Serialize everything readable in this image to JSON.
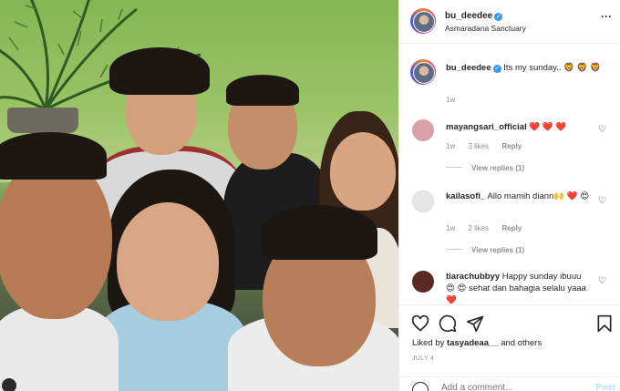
{
  "post": {
    "username": "bu_deedee",
    "location": "Asmaradana Sanctuary",
    "caption": "Its my sunday..",
    "caption_emoji": "🦁 🦁 🦁",
    "caption_time": "1w"
  },
  "comments": [
    {
      "username": "mayangsari_official",
      "text": "❤️ ❤️ ❤️",
      "time": "1w",
      "likes": "3 likes",
      "reply": "Reply",
      "view_replies": "View replies (1)",
      "avatar_color": "#d8a0a8"
    },
    {
      "username": "kailasofi_",
      "text": "Allo mamih diann🙌 ❤️ 😍",
      "time": "1w",
      "likes": "2 likes",
      "reply": "Reply",
      "view_replies": "View replies (1)",
      "avatar_color": "#e6e6e6"
    },
    {
      "username": "tiarachubbyy",
      "text": "Happy sunday ibuuu 😍 😍 sehat dan bahagia selalu yaaa❤️",
      "avatar_color": "#5a2a22"
    }
  ],
  "actions": {
    "icons": [
      "heart-icon",
      "comment-icon",
      "share-icon",
      "bookmark-icon"
    ],
    "liked_by_prefix": "Liked by",
    "liked_by_user": "tasyadeaa__",
    "liked_by_suffix": "and others",
    "date": "JULY 4"
  },
  "add_comment": {
    "placeholder": "Add a comment...",
    "post_label": "Post"
  },
  "colors": {
    "verified": "#3897f0",
    "secondary_text": "#8e8e8e",
    "post_disabled": "#b2dffc"
  }
}
